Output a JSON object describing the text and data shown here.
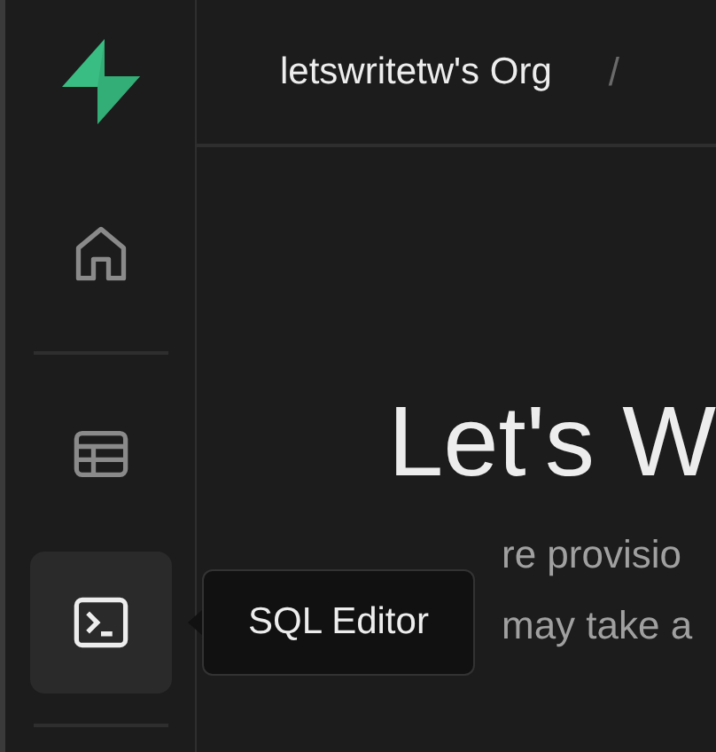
{
  "sidebar": {
    "items": [
      {
        "kind": "home",
        "selected": false
      },
      {
        "kind": "table",
        "selected": false
      },
      {
        "kind": "sql",
        "selected": true
      }
    ]
  },
  "tooltip": {
    "text": "SQL Editor"
  },
  "header": {
    "org": "letswritetw's Org",
    "separator": "/"
  },
  "main": {
    "heading": "Let's W",
    "lines": [
      "re provisio",
      "may take a"
    ]
  }
}
